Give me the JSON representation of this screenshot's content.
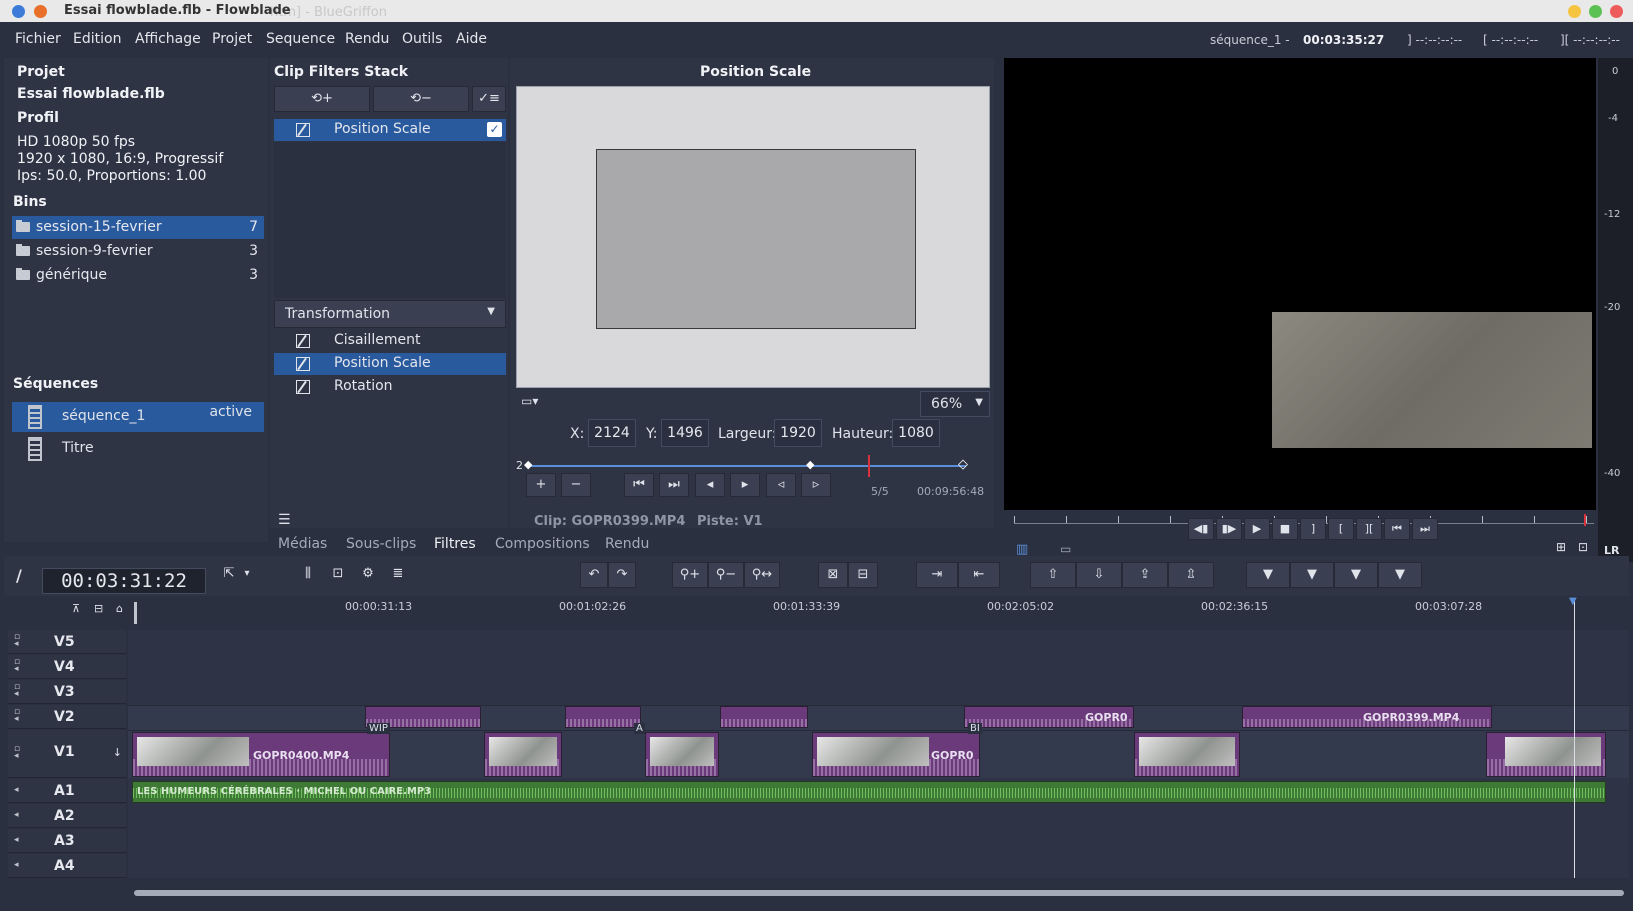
{
  "window": {
    "title": "Essai flowblade.flb - Flowblade",
    "ghost_title": "htm] - BlueGriffon"
  },
  "menu": [
    "Fichier",
    "Edition",
    "Affichage",
    "Projet",
    "Sequence",
    "Rendu",
    "Outils",
    "Aide"
  ],
  "header": {
    "sequence_name": "séquence_1 - ",
    "timecode": "00:03:35:27",
    "mark_out": "] --:--:--:--",
    "mark_in": "[ --:--:--:--",
    "range": "][ --:--:--:--"
  },
  "project": {
    "section_label": "Projet",
    "file_name": "Essai flowblade.flb",
    "profile_label": "Profil",
    "profile_lines": [
      "HD 1080p 50 fps",
      "1920 x 1080, 16:9, Progressif",
      "Ips: 50.0, Proportions: 1.00"
    ],
    "bins_label": "Bins",
    "bins": [
      {
        "name": "session-15-fevrier",
        "count": "7"
      },
      {
        "name": "session-9-fevrier",
        "count": "3"
      },
      {
        "name": "générique",
        "count": "3"
      }
    ],
    "sequences_label": "Séquences",
    "sequences": [
      {
        "name": "séquence_1",
        "status": "active"
      },
      {
        "name": "Titre",
        "status": ""
      }
    ]
  },
  "filters": {
    "title": "Clip Filters Stack",
    "add_label": "⟲+",
    "remove_label": "⟲−",
    "toggle_label": "✓≡",
    "stack": [
      {
        "name": "Position Scale",
        "checked": "✓"
      }
    ],
    "category": "Transformation",
    "list": [
      "Cisaillement",
      "Position Scale",
      "Rotation"
    ]
  },
  "editor": {
    "title": "Position Scale",
    "zoom": "66%",
    "x_label": "X:",
    "x_value": "2124",
    "y_label": "Y:",
    "y_value": "1496",
    "w_label": "Largeur:",
    "w_value": "1920",
    "h_label": "Hauteur:",
    "h_value": "1080",
    "kf_index": "2",
    "kf_count": "5/5",
    "kf_timecode": "00:09:56:48",
    "clip_info": "Clip: GOPR0399.MP4",
    "track_info": "Piste: V1",
    "kf_buttons": [
      "+",
      "−",
      "⏮",
      "⏭",
      "◂",
      "▸",
      "◃",
      "▹"
    ]
  },
  "tabs": [
    "Médias",
    "Sous-clips",
    "Filtres",
    "Compositions",
    "Rendu"
  ],
  "meter_labels": [
    "0",
    "-4",
    "-12",
    "-20",
    "-40"
  ],
  "meter_lr": "LR",
  "playback_buttons": [
    "◀▮",
    "▮▶",
    "▶",
    "■",
    "]",
    "[",
    "][",
    "⏮",
    "⏭"
  ],
  "timeline": {
    "timecode": "00:03:31:22",
    "ruler_ticks": [
      "00:00:31:13",
      "00:01:02:26",
      "00:01:33:39",
      "00:02:05:02",
      "00:02:36:15",
      "00:03:07:28"
    ],
    "tracks": [
      "V5",
      "V4",
      "V3",
      "V2",
      "V1",
      "A1",
      "A2",
      "A3",
      "A4"
    ],
    "clips": {
      "v1_first": "GOPR0400.MP4",
      "v1_mid": "GOPR0",
      "v2_a": "GOPR0",
      "v2_b": "GOPR0399.MP4",
      "wipe": "WIP",
      "mark_a": "A",
      "mark_b": "BI",
      "audio": "LES HUMEURS CÉRÉBRALES · MICHEL OU CAIRE.MP3"
    },
    "tools": [
      "⇱",
      "▾",
      "⫼",
      "⊡",
      "⚙",
      "≣",
      "↶",
      "↷",
      "⚲+",
      "⚲−",
      "⚲↔",
      "⊠",
      "⊟",
      "⇥",
      "⇤",
      "⇧",
      "⇩",
      "⇪",
      "⇫",
      "▼",
      "▼",
      "▼",
      "▼"
    ]
  },
  "colors": {
    "accent": "#2a5a9e",
    "clip_video": "#6b3a7a",
    "clip_audio": "#3e7a36",
    "playhead": "#d8323c"
  }
}
